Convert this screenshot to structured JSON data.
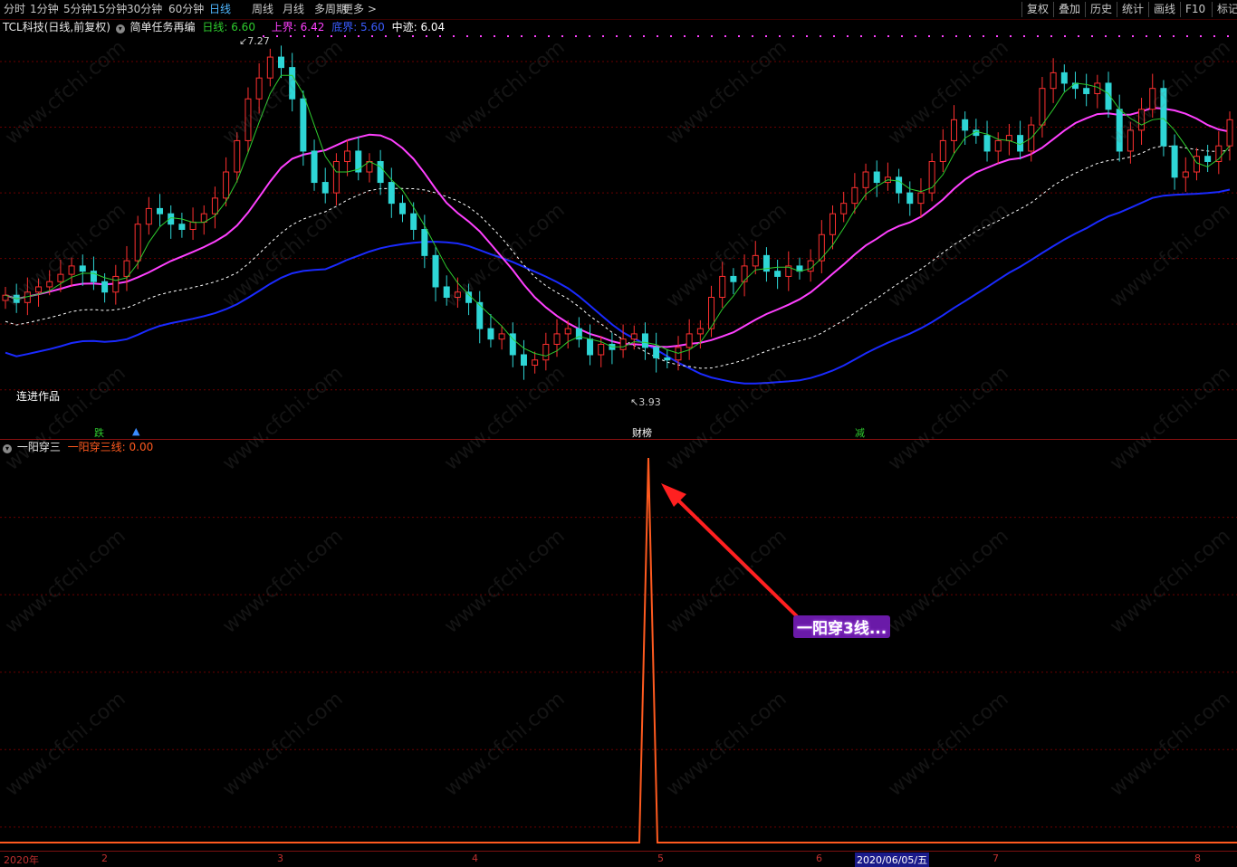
{
  "toolbar": {
    "periods": [
      "分时",
      "1分钟",
      "5分钟",
      "15分钟",
      "30分钟",
      "60分钟",
      "日线",
      "周线",
      "月线",
      "多周期",
      "更多 >"
    ],
    "active": "日线",
    "right_buttons": [
      "复权",
      "叠加",
      "历史",
      "统计",
      "画线",
      "F10",
      "标记"
    ]
  },
  "main_legend": {
    "stock": "TCL科技(日线,前复权)",
    "indicator": "简单任务再编",
    "items": [
      {
        "label": "日线: 6.60",
        "color": "#2ecc2e"
      },
      {
        "label": "上界: 6.42",
        "color": "#ff40ff"
      },
      {
        "label": "底界: 5.60",
        "color": "#3a5cff"
      },
      {
        "label": "中迹: 6.04",
        "color": "#ffffff"
      }
    ]
  },
  "main_annotations": {
    "high_label": "7.27",
    "low_label": "3.93",
    "author": "连进作品",
    "signal_1": "跌",
    "signal_2": "财榜",
    "signal_3": "减"
  },
  "indicator_legend": {
    "name": "一阳穿三",
    "value_label": "一阳穿三线: 0.00",
    "color": "#ff5a1f"
  },
  "callout": "一阳穿3线...",
  "xaxis": {
    "labels": [
      "2020年",
      "2",
      "3",
      "4",
      "5",
      "6",
      "2020/06/05/五",
      "7",
      "8"
    ]
  },
  "watermark": "www.cfchi.com",
  "colors": {
    "up": "#ff3030",
    "down": "#2ed6d6",
    "ma_short": "#2ecc2e",
    "upper": "#ff40ff",
    "lower": "#1a2aff",
    "mid": "#ffffff",
    "indicator": "#ff5a1f",
    "grid": "#6a0000"
  },
  "chart_data": {
    "type": "candlestick",
    "price_range": [
      3.7,
      7.4
    ],
    "indicator_range": [
      0,
      1
    ],
    "indicator_spike_value": 1,
    "closes": [
      4.92,
      4.85,
      4.95,
      5.0,
      5.05,
      5.12,
      5.2,
      5.15,
      5.05,
      4.95,
      5.1,
      5.25,
      5.6,
      5.75,
      5.7,
      5.6,
      5.55,
      5.62,
      5.7,
      5.85,
      6.1,
      6.4,
      6.8,
      7.0,
      7.2,
      7.1,
      6.8,
      6.3,
      6.0,
      5.9,
      6.2,
      6.3,
      6.1,
      6.2,
      6.0,
      5.8,
      5.7,
      5.55,
      5.3,
      5.0,
      4.9,
      4.95,
      4.85,
      4.6,
      4.5,
      4.55,
      4.35,
      4.25,
      4.3,
      4.45,
      4.55,
      4.6,
      4.5,
      4.35,
      4.45,
      4.4,
      4.5,
      4.55,
      4.42,
      4.32,
      4.3,
      4.42,
      4.55,
      4.6,
      4.9,
      5.1,
      5.05,
      5.2,
      5.3,
      5.15,
      5.1,
      5.2,
      5.15,
      5.25,
      5.5,
      5.7,
      5.8,
      5.95,
      6.1,
      6.0,
      6.05,
      5.9,
      5.8,
      5.9,
      6.2,
      6.4,
      6.6,
      6.5,
      6.45,
      6.3,
      6.4,
      6.45,
      6.3,
      6.55,
      6.9,
      7.05,
      6.95,
      6.9,
      6.85,
      6.95,
      6.7,
      6.3,
      6.5,
      6.7,
      6.9,
      6.35,
      6.05,
      6.1,
      6.25,
      6.2,
      6.35,
      6.6
    ]
  }
}
